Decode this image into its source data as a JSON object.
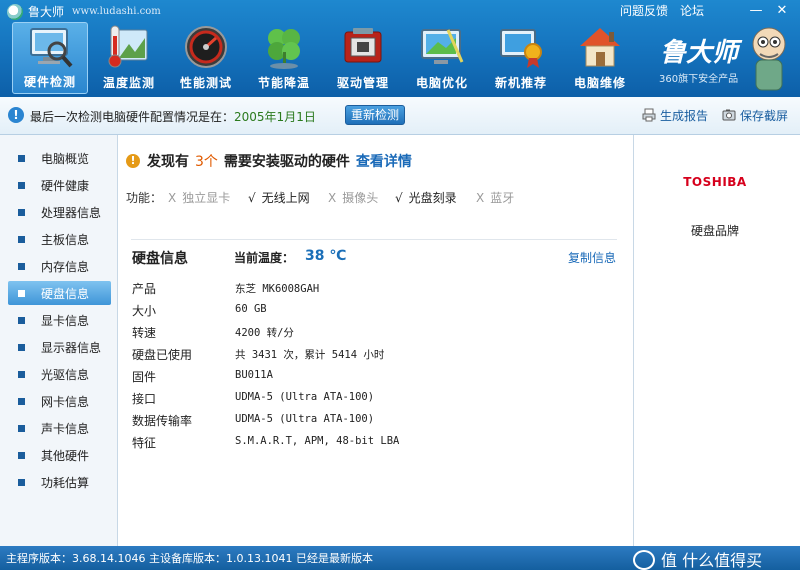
{
  "window": {
    "title": "鲁大师",
    "url": "www.ludashi.com",
    "links": {
      "feedback": "问题反馈",
      "forum": "论坛"
    },
    "controls": {
      "minimize": "—",
      "close": "✕"
    }
  },
  "toolbar": {
    "tabs": [
      {
        "label": "硬件检测",
        "icon": "monitor-magnifier-icon",
        "active": true
      },
      {
        "label": "温度监测",
        "icon": "thermometer-icon"
      },
      {
        "label": "性能测试",
        "icon": "speedometer-icon"
      },
      {
        "label": "节能降温",
        "icon": "clover-icon"
      },
      {
        "label": "驱动管理",
        "icon": "chip-box-icon"
      },
      {
        "label": "电脑优化",
        "icon": "optimize-screen-icon"
      },
      {
        "label": "新机推荐",
        "icon": "computer-award-icon"
      },
      {
        "label": "电脑维修",
        "icon": "house-repair-icon"
      }
    ],
    "brand": {
      "name": "鲁大师",
      "subtitle": "360旗下安全产品"
    }
  },
  "infobar": {
    "text": "最后一次检测电脑硬件配置情况是在：",
    "date": "2005年1月1日",
    "recheck_label": "重新检测",
    "report_label": "生成报告",
    "screenshot_label": "保存截屏"
  },
  "sidebar": {
    "items": [
      {
        "label": "电脑概览"
      },
      {
        "label": "硬件健康"
      },
      {
        "label": "处理器信息"
      },
      {
        "label": "主板信息"
      },
      {
        "label": "内存信息"
      },
      {
        "label": "硬盘信息",
        "active": true
      },
      {
        "label": "显卡信息"
      },
      {
        "label": "显示器信息"
      },
      {
        "label": "光驱信息"
      },
      {
        "label": "网卡信息"
      },
      {
        "label": "声卡信息"
      },
      {
        "label": "其他硬件"
      },
      {
        "label": "功耗估算"
      }
    ]
  },
  "main": {
    "warning": {
      "prefix": "发现有",
      "count": "3个",
      "suffix": "需要安装驱动的硬件",
      "link": "查看详情"
    },
    "features": {
      "label": "功能：",
      "items": [
        {
          "mark": "X",
          "label": "独立显卡",
          "supported": false
        },
        {
          "mark": "√",
          "label": "无线上网",
          "supported": true
        },
        {
          "mark": "X",
          "label": "摄像头",
          "supported": false
        },
        {
          "mark": "√",
          "label": "光盘刻录",
          "supported": true
        },
        {
          "mark": "X",
          "label": "蓝牙",
          "supported": false
        }
      ]
    },
    "disk": {
      "title": "硬盘信息",
      "temp_label": "当前温度：",
      "temp_value": "38 ℃",
      "copy_label": "复制信息",
      "rows": [
        {
          "key": "产品",
          "value": "东芝  MK6008GAH"
        },
        {
          "key": "大小",
          "value": "60 GB"
        },
        {
          "key": "转速",
          "value": "4200 转/分"
        },
        {
          "key": "硬盘已使用",
          "value": "共 3431 次，累计 5414 小时"
        },
        {
          "key": "固件",
          "value": "BU011A"
        },
        {
          "key": "接口",
          "value": "UDMA-5 (Ultra ATA-100)"
        },
        {
          "key": "数据传输率",
          "value": "UDMA-5 (Ultra ATA-100)"
        },
        {
          "key": "特征",
          "value": "S.M.A.R.T,  APM,  48-bit LBA"
        }
      ]
    }
  },
  "rightpanel": {
    "logo_text": "TOSHIBA",
    "caption": "硬盘品牌"
  },
  "statusbar": {
    "text": "主程序版本：3.68.14.1046   主设备库版本：1.0.13.1041   已经是最新版本",
    "watermark": "值 什么值得买"
  },
  "colors": {
    "toolbar_blue": "#1676c0",
    "accent_orange": "#e05a00",
    "link_blue": "#1a6ab8",
    "brand_red": "#d6001c"
  }
}
